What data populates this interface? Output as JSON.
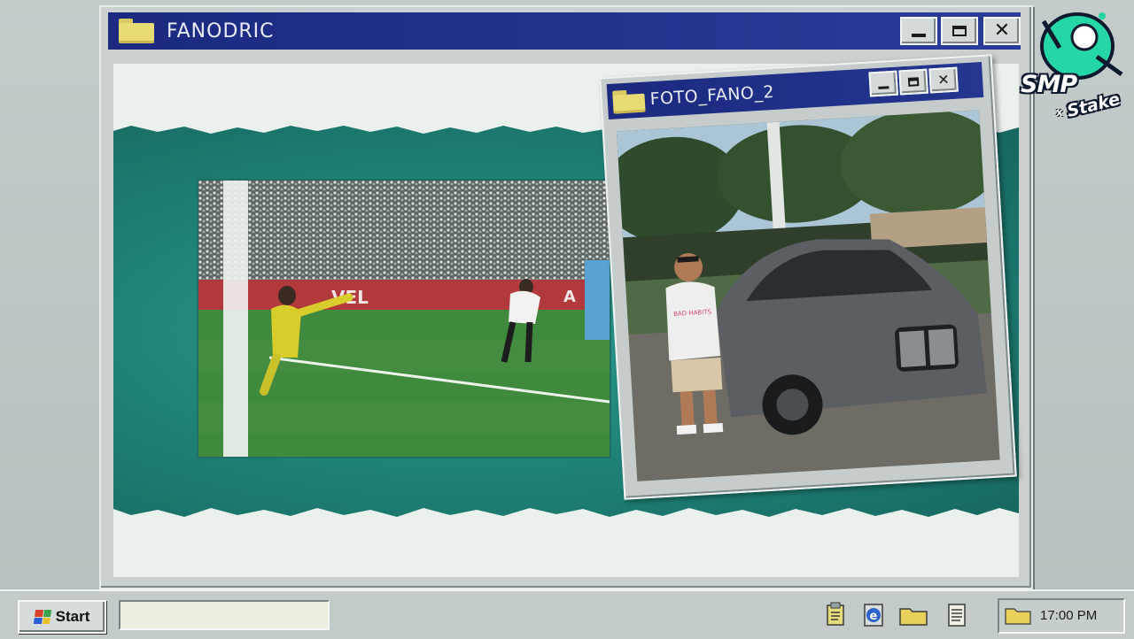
{
  "main_window": {
    "title": "FANODRIC",
    "buttons": {
      "minimize": "minimize",
      "maximize": "maximize",
      "close": "✕"
    }
  },
  "photo_window": {
    "title": "FOTO_FANO_2",
    "buttons": {
      "minimize": "minimize",
      "maximize": "maximize",
      "close": "✕"
    }
  },
  "video_clip": {
    "ad_board_text": "VEL",
    "ad_board_text_right": "A"
  },
  "photo": {
    "shirt_text": "BAD HABITS"
  },
  "logo": {
    "line1": "SMP",
    "separator": "x",
    "line2": "Stake"
  },
  "taskbar": {
    "start_label": "Start",
    "search_value": "",
    "tray_icons": [
      "clipboard-icon",
      "browser-e-icon",
      "folder-icon",
      "notepad-icon"
    ],
    "clock": "17:00 PM"
  },
  "colors": {
    "titlebar": "#1b2a80",
    "teal": "#1e7f74",
    "window_gray": "#c9d0cf",
    "folder_yellow": "#e7dc74"
  }
}
